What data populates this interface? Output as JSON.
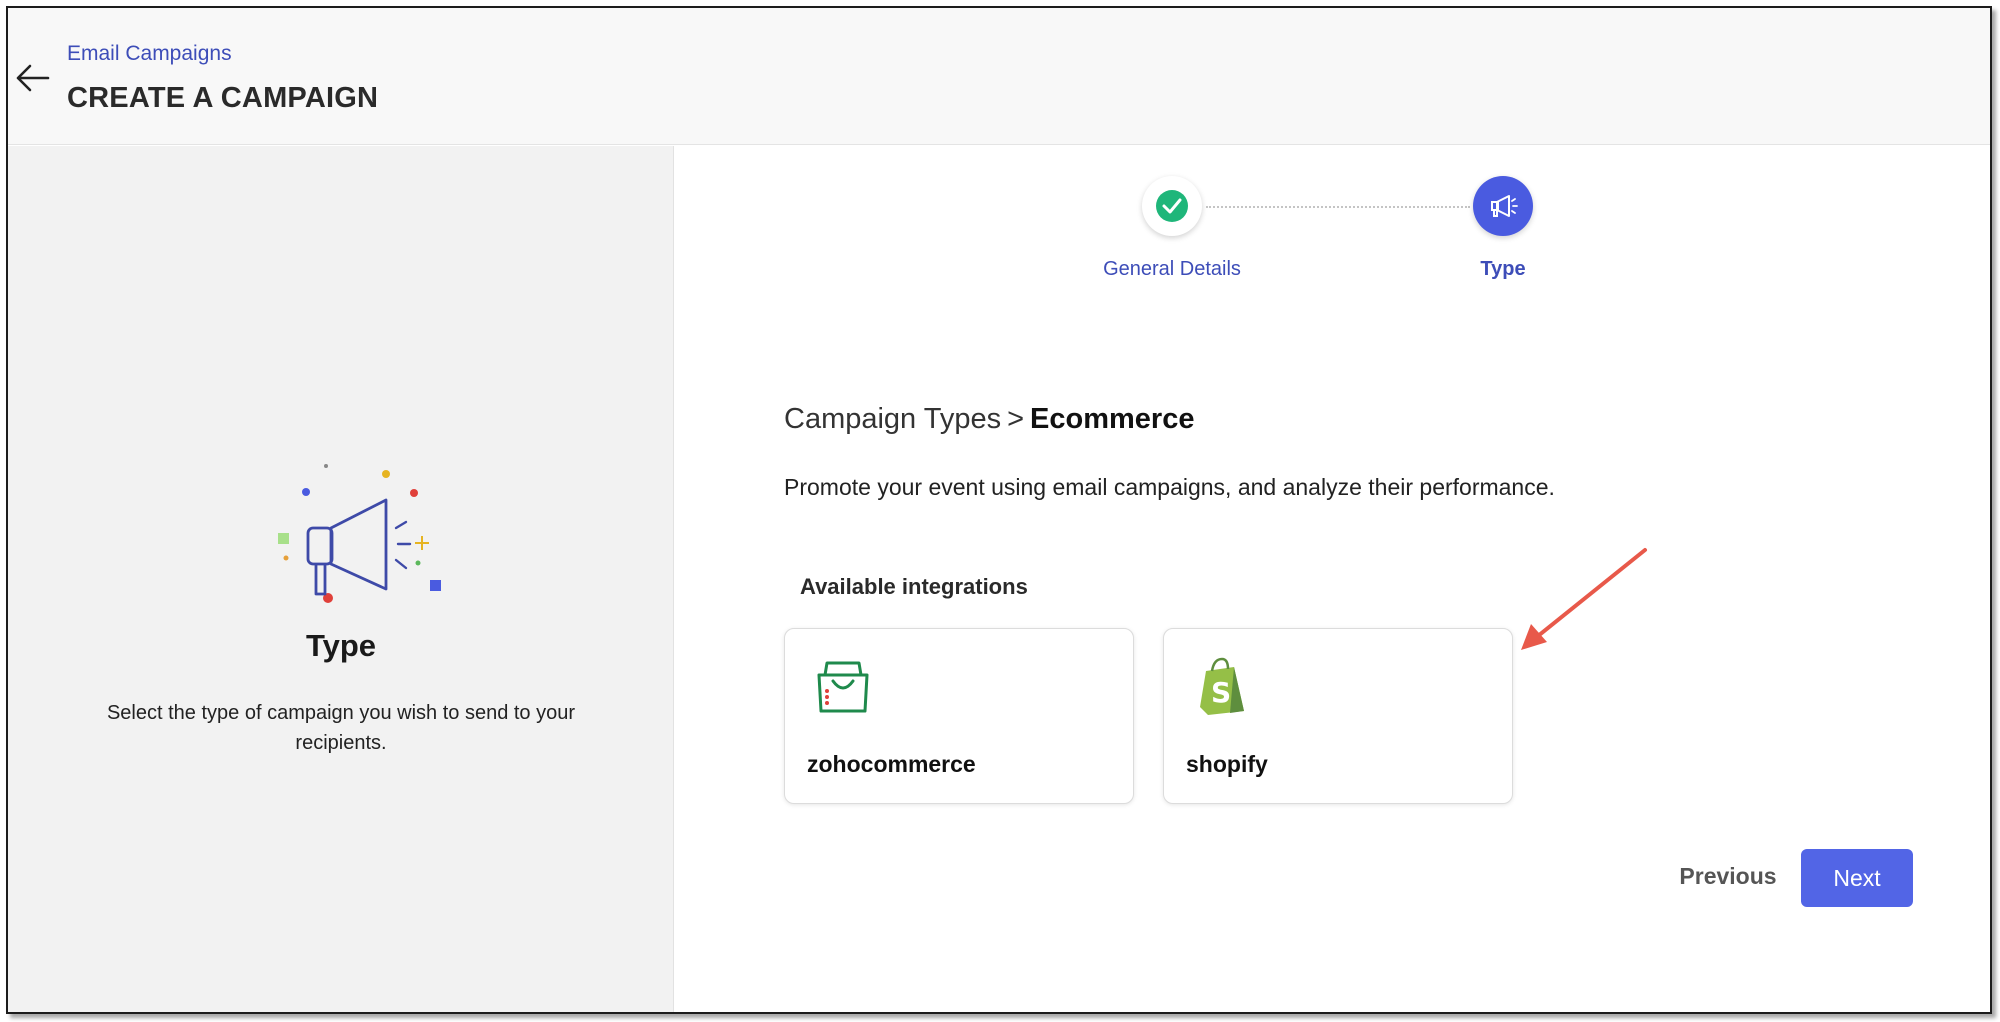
{
  "header": {
    "breadcrumb_link": "Email Campaigns",
    "title": "CREATE A CAMPAIGN",
    "back_icon": "arrow-left-icon"
  },
  "left_panel": {
    "illustration_icon": "megaphone-icon",
    "title": "Type",
    "description": "Select the type of campaign you wish to send to your recipients."
  },
  "stepper": {
    "steps": [
      {
        "label": "General Details",
        "status": "completed",
        "icon": "check-icon"
      },
      {
        "label": "Type",
        "status": "active",
        "icon": "megaphone-icon"
      }
    ]
  },
  "main": {
    "breadcrumb": {
      "parent": "Campaign Types",
      "separator": ">",
      "current": "Ecommerce"
    },
    "description": "Promote your event using email campaigns, and analyze their performance.",
    "integrations_title": "Available integrations",
    "integrations": [
      {
        "label": "zohocommerce",
        "icon": "shopping-bag-icon"
      },
      {
        "label": "shopify",
        "icon": "shopify-bag-icon"
      }
    ]
  },
  "footer": {
    "previous_label": "Previous",
    "next_label": "Next"
  },
  "colors": {
    "accent": "#4a5be0",
    "link": "#3d4db8",
    "success": "#1fb67a",
    "annotation_arrow": "#e8594a"
  }
}
